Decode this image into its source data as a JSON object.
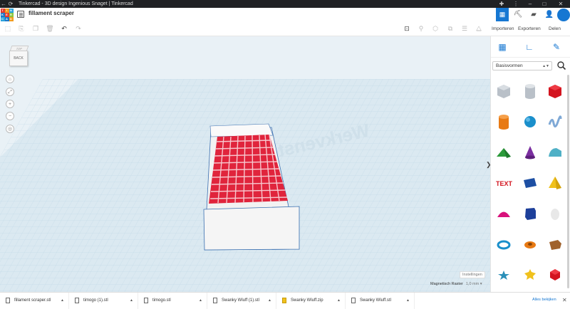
{
  "titlebar": {
    "title": "Tinkercad - 3D design Ingenious Snaget | Tinkercad",
    "back_glyph": "←",
    "reload_glyph": "⟳",
    "minimize_glyph": "–",
    "maximize_glyph": "□",
    "close_glyph": "✕"
  },
  "header": {
    "logo_letters": [
      "TIN",
      "KER",
      "CAD"
    ],
    "design_name": "fillament scraper",
    "icons": [
      "grid-view-icon",
      "pickaxe-icon",
      "blocks-icon",
      "user-add-icon",
      "avatar"
    ]
  },
  "toolbar": {
    "import_label": "Importeren",
    "export_label": "Exporteren",
    "share_label": "Delen"
  },
  "viewport": {
    "workplane_label": "Werkvenster",
    "viewcube_label": "BACK",
    "viewcube_top_label": "TOP",
    "settings_label": "Instellingen",
    "snap_label": "Magnetisch Raster",
    "snap_value": "1,0 mm ▾",
    "collapse_glyph": "❯"
  },
  "panel": {
    "dropdown_value": "Basisvormen",
    "shapes": [
      "box-hole",
      "cylinder-hole",
      "box",
      "cylinder",
      "sphere",
      "scribble",
      "roof",
      "cone",
      "round-roof",
      "text",
      "half-sphere-blue",
      "pyramid",
      "paraboloid",
      "polygon",
      "egg",
      "torus",
      "tube",
      "half-sphere-brown",
      "star",
      "heart",
      "icosahedron"
    ]
  },
  "downloads": {
    "items": [
      "fillament scraper.stl",
      "timogo (1).stl",
      "timogo.stl",
      "Swanky Wluff (1).stl",
      "Swanky Wluff.zip",
      "Swanky Wluff.stl"
    ],
    "show_all_label": "Alles bekijken"
  },
  "colors": {
    "accent": "#1677d2",
    "model_red": "#e0243c",
    "grid_bg": "#e9f1f6"
  }
}
